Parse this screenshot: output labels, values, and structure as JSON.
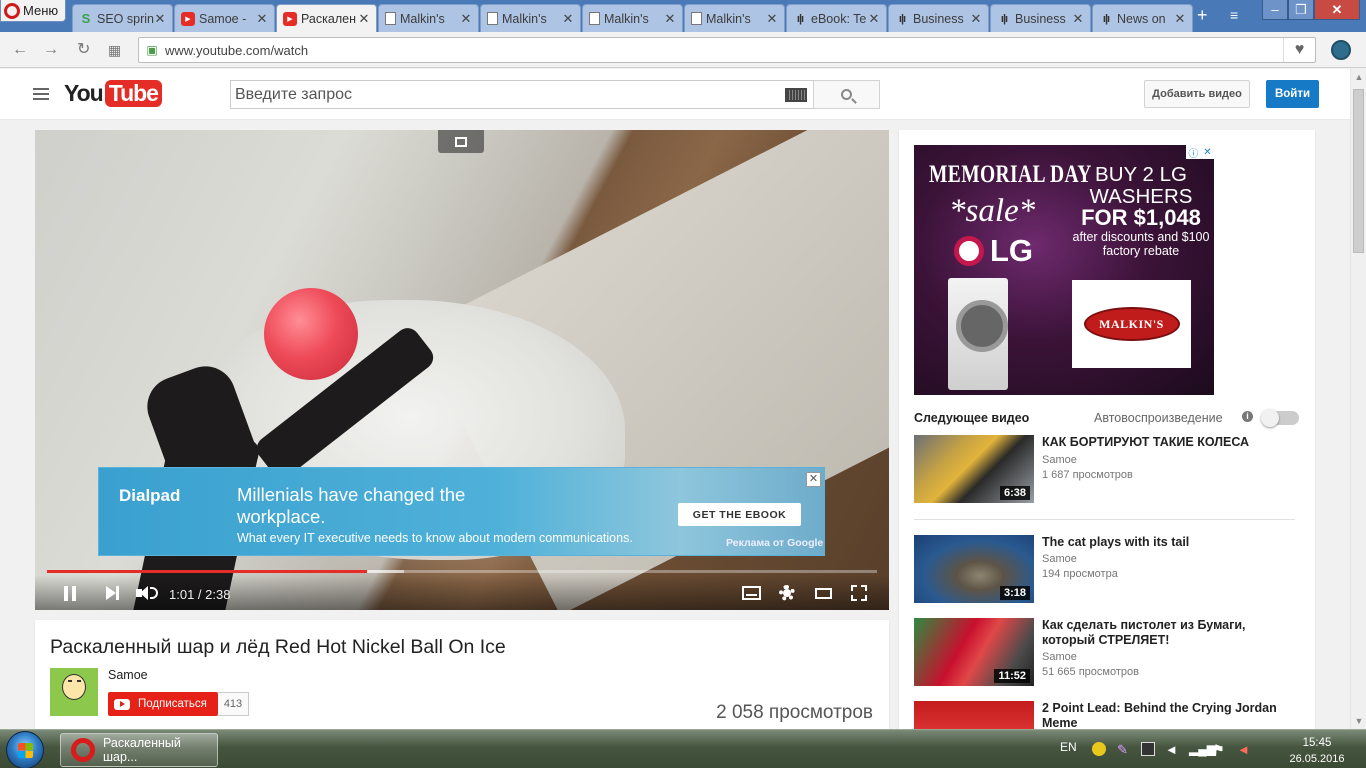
{
  "browser": {
    "menu_label": "Меню",
    "tabs": [
      {
        "label": "SEO sprin",
        "icon": "seo-icon",
        "active": false
      },
      {
        "label": "Samoe - ",
        "icon": "youtube-icon",
        "active": false
      },
      {
        "label": "Раскален",
        "icon": "youtube-icon",
        "active": true
      },
      {
        "label": "Malkin's ",
        "icon": "page-icon",
        "active": false
      },
      {
        "label": "Malkin's ",
        "icon": "page-icon",
        "active": false
      },
      {
        "label": "Malkin's ",
        "icon": "page-icon",
        "active": false
      },
      {
        "label": "Malkin's ",
        "icon": "page-icon",
        "active": false
      },
      {
        "label": "eBook: Te",
        "icon": "wave-icon",
        "active": false
      },
      {
        "label": "Business",
        "icon": "wave-icon",
        "active": false
      },
      {
        "label": "Business",
        "icon": "wave-icon",
        "active": false
      },
      {
        "label": "News on",
        "icon": "wave-icon",
        "active": false
      }
    ],
    "url": "www.youtube.com/watch"
  },
  "header": {
    "logo_you": "You",
    "logo_tube": "Tube",
    "search_placeholder": "Введите запрос",
    "upload_label": "Добавить видео",
    "signin_label": "Войти"
  },
  "player": {
    "time_text": "1:01 / 2:38",
    "played_fraction": 0.3855,
    "loaded_fraction": 0.43,
    "overlay_ad": {
      "brand": "Dialpad",
      "headline": "Millenials have changed the workplace.",
      "subline": "What every IT executive needs to know about modern communications.",
      "cta": "GET THE EBOOK",
      "label": "Реклама от Google",
      "close": "✕"
    }
  },
  "video": {
    "title": "Раскаленный шар и лёд Red Hot Nickel Ball On Ice",
    "channel": "Samoe",
    "subscribe_label": "Подписаться",
    "subscriber_count": "413",
    "views": "2 058 просмотров"
  },
  "sidebar_ad": {
    "memorial": "MEMORIAL DAY",
    "sale": "*sale*",
    "lg": "LG",
    "buy_line": "BUY 2 LG WASHERS",
    "price": "FOR $1,048",
    "discount": "after discounts and $100 factory rebate",
    "malkins": "MALKIN'S"
  },
  "up_next": {
    "label": "Следующее видео",
    "autoplay_label": "Автовоспроизведение",
    "autoplay_on": false,
    "items": [
      {
        "title": "КАК БОРТИРУЮТ ТАКИЕ КОЛЕСА",
        "channel": "Samoe",
        "views": "1 687 просмотров",
        "duration": "6:38"
      },
      {
        "title": "The cat plays with its tail",
        "channel": "Samoe",
        "views": "194 просмотра",
        "duration": "3:18"
      },
      {
        "title": "Как сделать пистолет из Бумаги, который СТРЕЛЯЕТ!",
        "channel": "Samoe",
        "views": "51 665 просмотров",
        "duration": "11:52"
      },
      {
        "title": "2 Point Lead: Behind the Crying Jordan Meme",
        "channel": "",
        "views": "",
        "duration": ""
      }
    ]
  },
  "taskbar": {
    "window_label": "Раскаленный шар...",
    "language": "EN",
    "time": "15:45",
    "date": "26.05.2016"
  }
}
